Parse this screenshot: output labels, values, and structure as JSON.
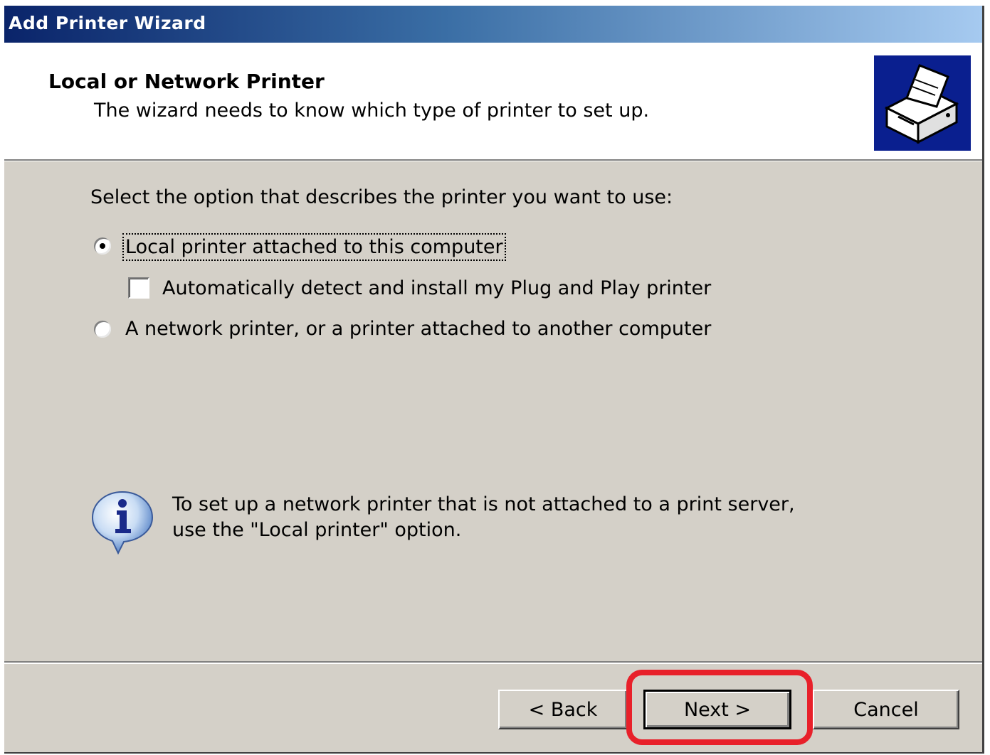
{
  "window": {
    "title": "Add Printer Wizard"
  },
  "header": {
    "title": "Local or Network Printer",
    "subtitle": "The wizard needs to know which type of printer to set up.",
    "icon": "printer-icon"
  },
  "body": {
    "prompt": "Select the option that describes the printer you want to use:",
    "options": [
      {
        "label": "Local printer attached to this computer",
        "selected": true
      },
      {
        "label": "A network printer, or a printer attached to another computer",
        "selected": false
      }
    ],
    "checkbox": {
      "label": "Automatically detect and install my Plug and Play printer",
      "checked": false
    },
    "info": {
      "icon": "info-icon",
      "line1": "To set up a network printer that is not attached to a print server,",
      "line2": "use the \"Local printer\" option."
    }
  },
  "buttons": {
    "back": "< Back",
    "next": "Next >",
    "cancel": "Cancel"
  },
  "colors": {
    "dialog_face": "#d4d0c8",
    "titlebar_start": "#0a246a",
    "titlebar_end": "#a6caf0",
    "highlight_ring": "#e8202a",
    "header_icon_bg": "#0a1f8f"
  }
}
